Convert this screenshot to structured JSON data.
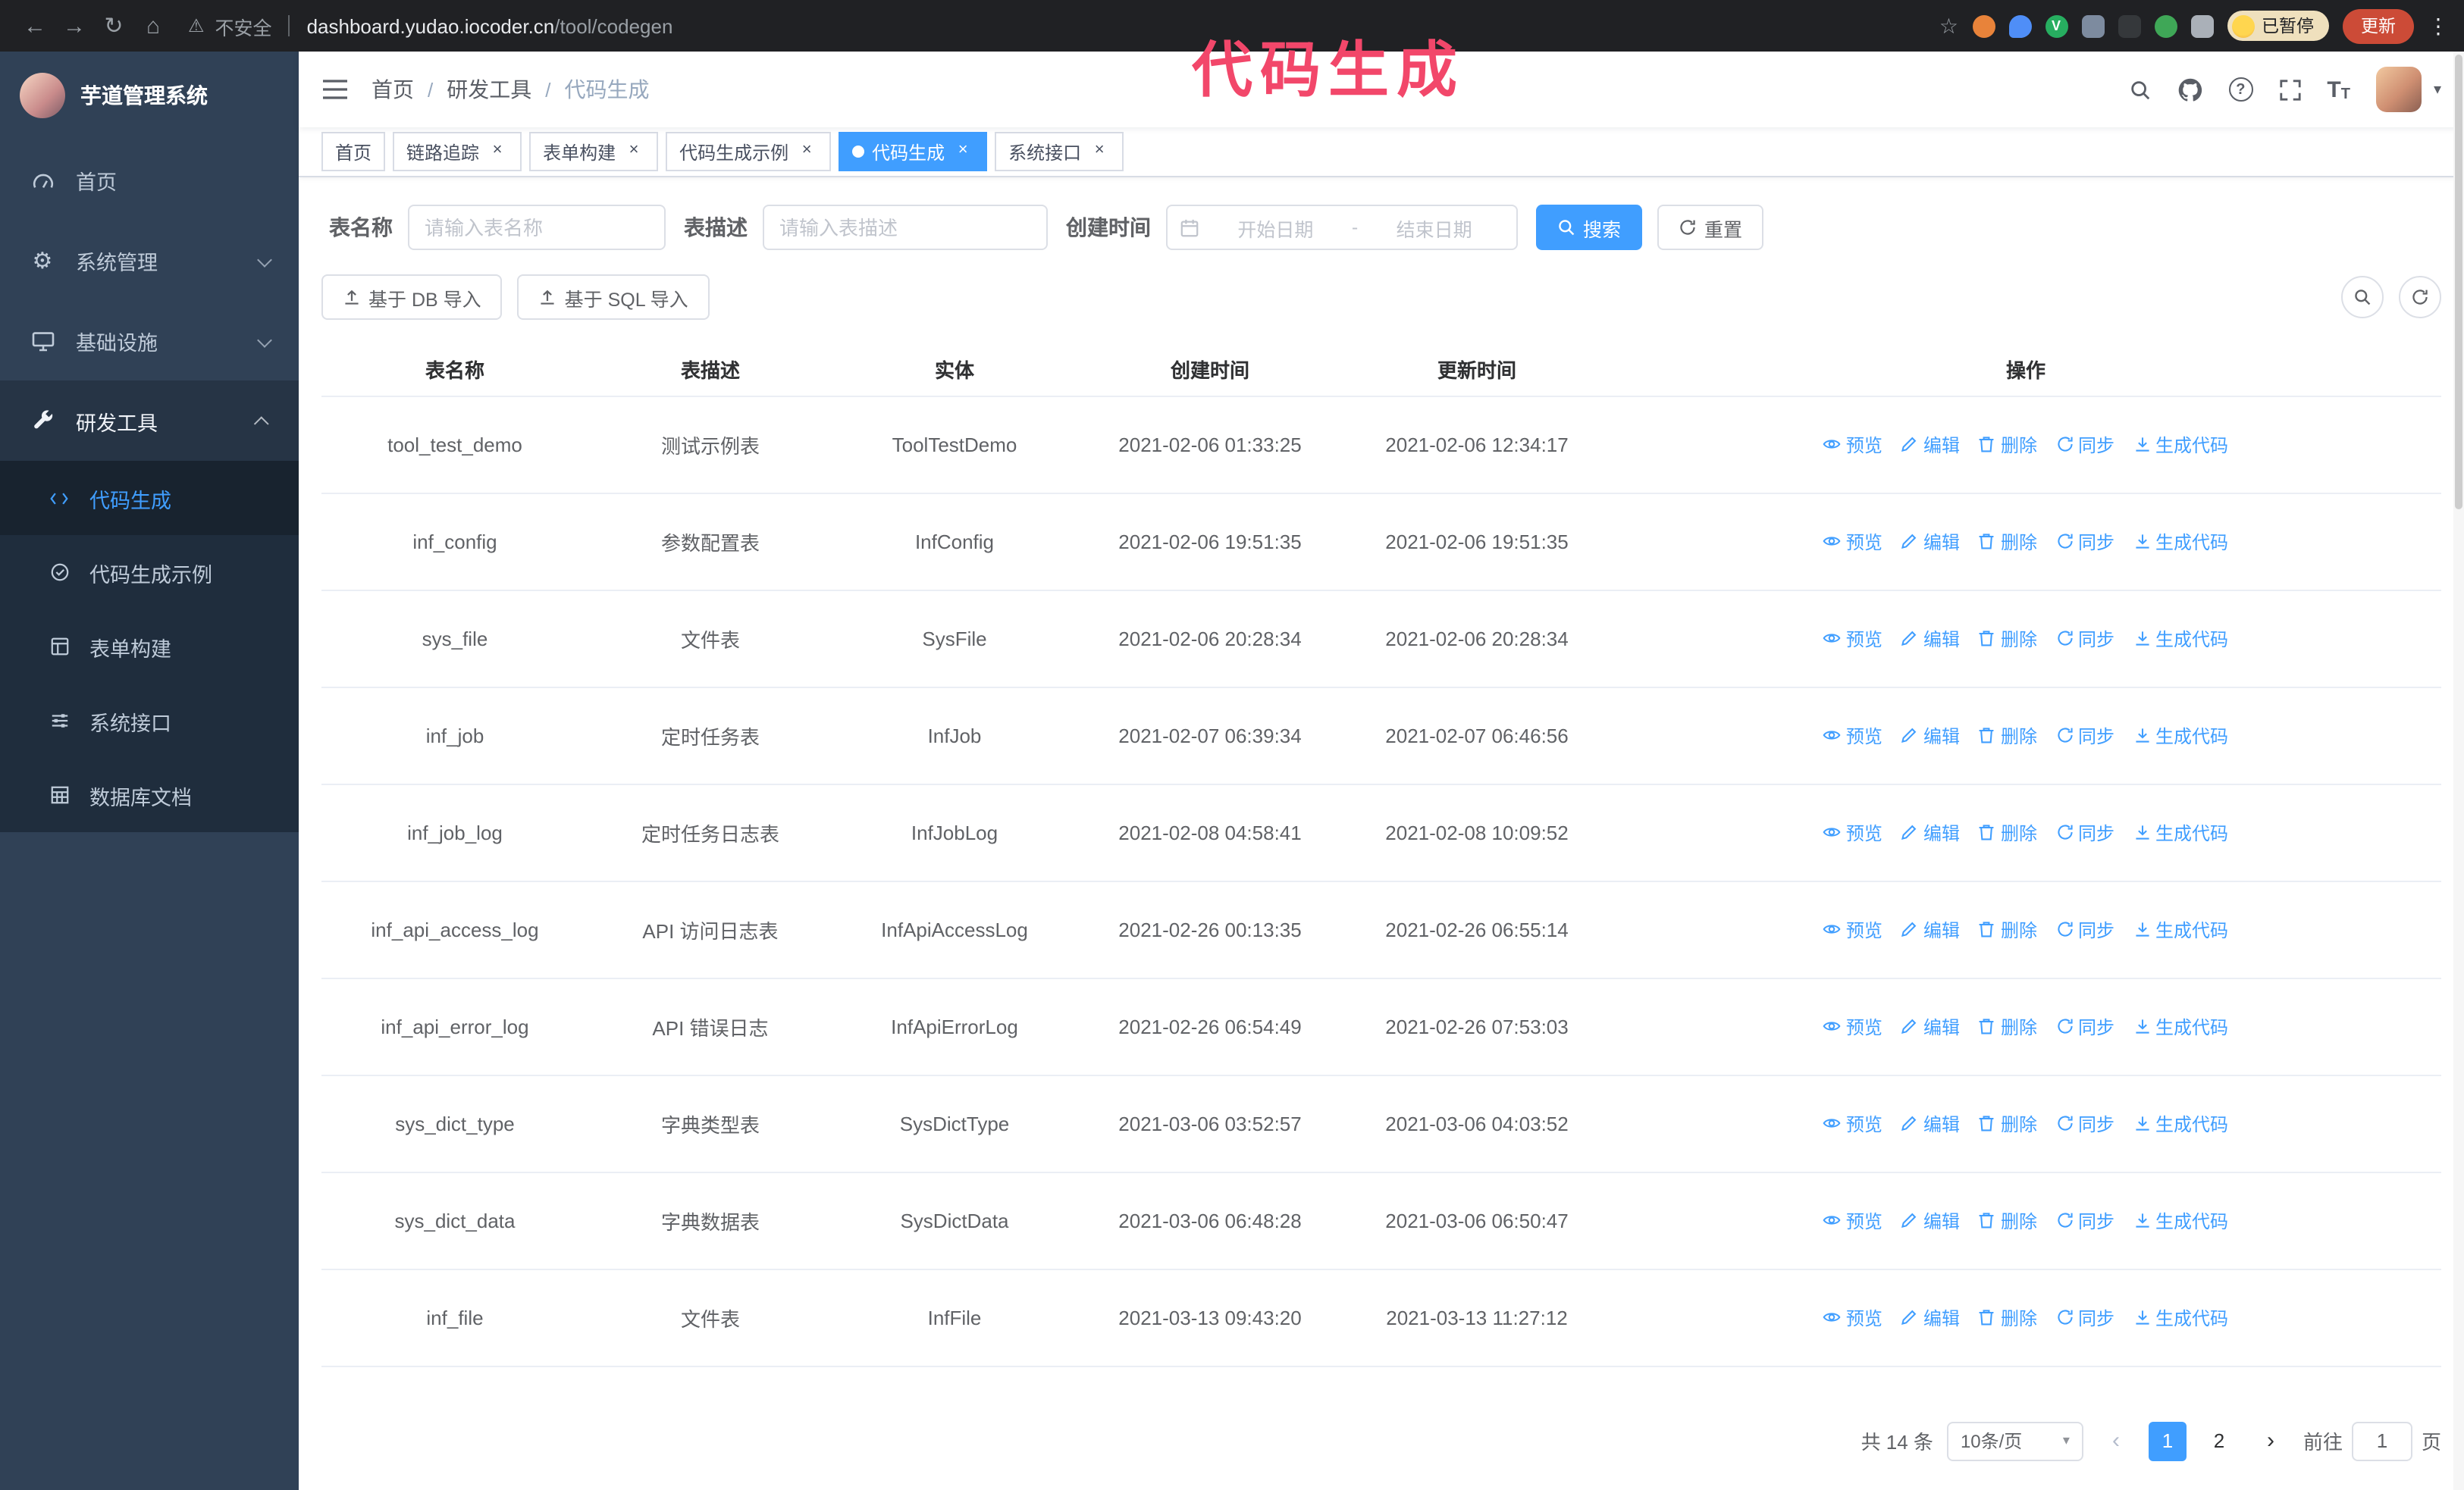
{
  "accent_color": "#409eff",
  "annotation": {
    "text": "代码生成",
    "color": "#f2476a"
  },
  "browser": {
    "security_label": "不安全",
    "url_domain": "dashboard.yudao.iocoder.cn",
    "url_path": "/tool/codegen",
    "profile_chip_label": "已暂停",
    "update_button_label": "更新",
    "vue_badge": "V"
  },
  "icons": {
    "back": "←",
    "forward": "→",
    "reload": "↻",
    "home": "⌂",
    "warning": "⚠",
    "star": "☆",
    "kebab": "⋮",
    "caret_down": "▾",
    "close": "×",
    "help": "?",
    "prev": "‹",
    "next": "›",
    "font_large": "T",
    "font_small": "T",
    "gear": "⚙"
  },
  "sidebar": {
    "logo_title": "芋道管理系统",
    "items": [
      {
        "label": "首页"
      },
      {
        "label": "系统管理"
      },
      {
        "label": "基础设施"
      },
      {
        "label": "研发工具"
      }
    ],
    "submenu": [
      {
        "label": "代码生成"
      },
      {
        "label": "代码生成示例"
      },
      {
        "label": "表单构建"
      },
      {
        "label": "系统接口"
      },
      {
        "label": "数据库文档"
      }
    ]
  },
  "header": {
    "breadcrumb": [
      "首页",
      "研发工具",
      "代码生成"
    ],
    "separator": "/"
  },
  "tabs": [
    {
      "label": "首页"
    },
    {
      "label": "链路追踪"
    },
    {
      "label": "表单构建"
    },
    {
      "label": "代码生成示例"
    },
    {
      "label": "代码生成"
    },
    {
      "label": "系统接口"
    }
  ],
  "filters": {
    "table_name_label": "表名称",
    "table_name_placeholder": "请输入表名称",
    "table_desc_label": "表描述",
    "table_desc_placeholder": "请输入表描述",
    "create_time_label": "创建时间",
    "date_start_placeholder": "开始日期",
    "date_separator": "-",
    "date_end_placeholder": "结束日期",
    "search_button_label": "搜索",
    "reset_button_label": "重置"
  },
  "toolbar": {
    "import_db_label": "基于 DB 导入",
    "import_sql_label": "基于 SQL 导入"
  },
  "table": {
    "columns": [
      "表名称",
      "表描述",
      "实体",
      "创建时间",
      "更新时间",
      "操作"
    ],
    "actions": [
      "预览",
      "编辑",
      "删除",
      "同步",
      "生成代码"
    ],
    "rows": [
      {
        "name": "tool_test_demo",
        "desc": "测试示例表",
        "entity": "ToolTestDemo",
        "created": "2021-02-06 01:33:25",
        "updated": "2021-02-06 12:34:17"
      },
      {
        "name": "inf_config",
        "desc": "参数配置表",
        "entity": "InfConfig",
        "created": "2021-02-06 19:51:35",
        "updated": "2021-02-06 19:51:35"
      },
      {
        "name": "sys_file",
        "desc": "文件表",
        "entity": "SysFile",
        "created": "2021-02-06 20:28:34",
        "updated": "2021-02-06 20:28:34"
      },
      {
        "name": "inf_job",
        "desc": "定时任务表",
        "entity": "InfJob",
        "created": "2021-02-07 06:39:34",
        "updated": "2021-02-07 06:46:56"
      },
      {
        "name": "inf_job_log",
        "desc": "定时任务日志表",
        "entity": "InfJobLog",
        "created": "2021-02-08 04:58:41",
        "updated": "2021-02-08 10:09:52"
      },
      {
        "name": "inf_api_access_log",
        "desc": "API 访问日志表",
        "entity": "InfApiAccessLog",
        "created": "2021-02-26 00:13:35",
        "updated": "2021-02-26 06:55:14"
      },
      {
        "name": "inf_api_error_log",
        "desc": "API 错误日志",
        "entity": "InfApiErrorLog",
        "created": "2021-02-26 06:54:49",
        "updated": "2021-02-26 07:53:03"
      },
      {
        "name": "sys_dict_type",
        "desc": "字典类型表",
        "entity": "SysDictType",
        "created": "2021-03-06 03:52:57",
        "updated": "2021-03-06 04:03:52"
      },
      {
        "name": "sys_dict_data",
        "desc": "字典数据表",
        "entity": "SysDictData",
        "created": "2021-03-06 06:48:28",
        "updated": "2021-03-06 06:50:47"
      },
      {
        "name": "inf_file",
        "desc": "文件表",
        "entity": "InfFile",
        "created": "2021-03-13 09:43:20",
        "updated": "2021-03-13 11:27:12"
      }
    ]
  },
  "pagination": {
    "total_label": "共 14 条",
    "page_size_label": "10条/页",
    "pages": [
      "1",
      "2"
    ],
    "goto_label": "前往",
    "goto_value": "1",
    "goto_suffix": "页"
  }
}
